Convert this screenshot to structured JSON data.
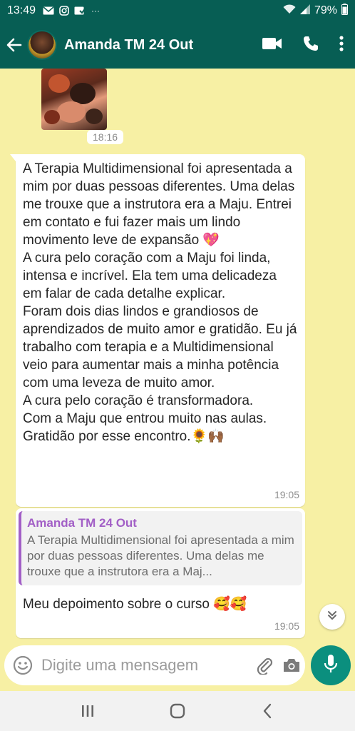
{
  "status_bar": {
    "time": "13:49",
    "more_indicator": "···",
    "battery": "79%",
    "icons": [
      "mail-icon",
      "instagram-icon",
      "mail-check-icon",
      "wifi-icon",
      "signal-icon",
      "battery-icon"
    ]
  },
  "header": {
    "contact_name": "Amanda TM 24 Out",
    "icons": [
      "back-arrow-icon",
      "video-call-icon",
      "phone-icon",
      "more-vert-icon"
    ],
    "color": "#075e54"
  },
  "messages": {
    "image_time": "18:16",
    "first": {
      "paragraphs": [
        "A Terapia Multidimensional foi apresentada a mim por duas pessoas diferentes. Uma delas me trouxe que  a instrutora era a Maju. Entrei em contato e fui fazer mais um lindo movimento leve de expansão 💖",
        "A cura pelo coração com a Maju foi linda, intensa e incrível. Ela tem uma delicadeza em falar de cada detalhe explicar.",
        "Foram dois dias lindos e grandiosos de aprendizados de muito amor e gratidão. Eu já trabalho com terapia e a Multidimensional veio para aumentar mais a minha potência com uma  leveza de muito amor.",
        "A cura pelo coração é transformadora.",
        "Com a Maju que entrou muito nas aulas.",
        "Gratidão por esse encontro.🌻🙌🏾"
      ],
      "time": "19:05"
    },
    "second": {
      "quote_author": "Amanda TM 24 Out",
      "quote_text": "A Terapia Multidimensional foi apresentada a mim por duas pessoas diferentes. Uma delas me trouxe que  a instrutora era a Maj...",
      "text": "Meu depoimento sobre o curso 🥰🥰",
      "time": "19:05"
    }
  },
  "composer": {
    "placeholder": "Digite uma mensagem"
  },
  "colors": {
    "chat_background": "#f7f0a4",
    "quote_accent": "#a25fc6",
    "mic_button": "#0b8f7e"
  }
}
